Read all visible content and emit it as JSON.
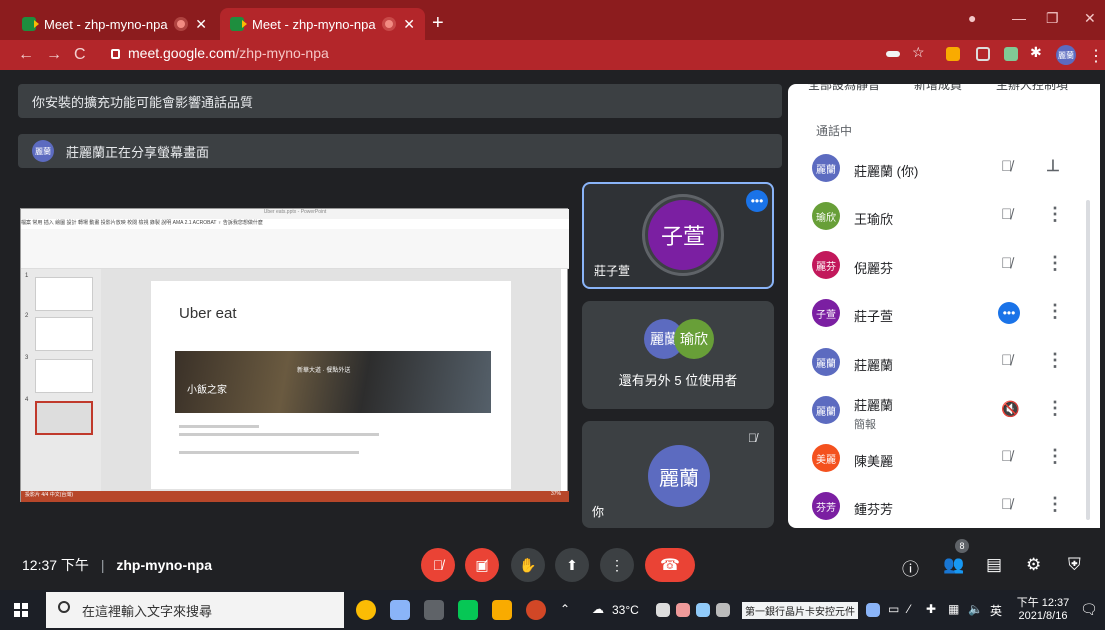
{
  "browser": {
    "tabs": [
      {
        "label": "Meet - zhp-myno-npa"
      },
      {
        "label": "Meet - zhp-myno-npa"
      }
    ],
    "new_tab": "+",
    "url_host": "meet.google.com",
    "url_path": "/zhp-myno-npa",
    "profile_initials": "麗蘭"
  },
  "meeting": {
    "banner_ext": "你安裝的擴充功能可能會影響通話品質",
    "banner_share": "莊麗蘭正在分享螢幕畫面",
    "sharer_initials": "麗蘭",
    "slide": {
      "window_title": "Uber eats.pptx - PowerPoint",
      "menu": "檔案 常用 插入 繪圖 設計 轉場 動畫 投影片放映 校閱 檢視 錄製 說明 AMA 2.1 ACROBAT ♀ 告訴我您想做什麼",
      "title": "Uber eat",
      "photo_title": "小飯之家",
      "photo_caption": "新華大道 · 餐點外送",
      "status": "投影片 4/4  中文(台灣)",
      "slide_numbers": [
        "1",
        "2",
        "3",
        "4"
      ],
      "zoom": "37%"
    },
    "tiles": [
      {
        "name": "莊子萱",
        "initials": "子萱",
        "color": "#7b1fa2"
      },
      {
        "name": "還有另外 5 位使用者",
        "initials_a": "麗蘭",
        "initials_b": "瑜欣",
        "color_a": "#5c6bc0",
        "color_b": "#689f38"
      },
      {
        "name": "你",
        "initials": "麗蘭",
        "color": "#5c6bc0"
      }
    ]
  },
  "panel": {
    "actions": [
      "全部設為靜音",
      "新增成員",
      "主辦人控制項"
    ],
    "section": "通話中",
    "people": [
      {
        "initials": "麗蘭",
        "name": "莊麗蘭 (你)",
        "sub": "",
        "color": "#5c6bc0",
        "mic": "mic-off",
        "action": "pin"
      },
      {
        "initials": "瑜欣",
        "name": "王瑜欣",
        "sub": "",
        "color": "#689f38",
        "mic": "mic-off",
        "action": "more"
      },
      {
        "initials": "麗芬",
        "name": "倪麗芬",
        "sub": "",
        "color": "#c2185b",
        "mic": "mic-off",
        "action": "more"
      },
      {
        "initials": "子萱",
        "name": "莊子萱",
        "sub": "",
        "color": "#7b1fa2",
        "mic": "speaking",
        "action": "more"
      },
      {
        "initials": "麗蘭",
        "name": "莊麗蘭",
        "sub": "",
        "color": "#5c6bc0",
        "mic": "mic-off",
        "action": "more"
      },
      {
        "initials": "麗蘭",
        "name": "莊麗蘭",
        "sub": "簡報",
        "color": "#5c6bc0",
        "mic": "presentation-muted",
        "action": "more"
      },
      {
        "initials": "美麗",
        "name": "陳美麗",
        "sub": "",
        "color": "#f4511e",
        "mic": "mic-off",
        "action": "more"
      },
      {
        "initials": "芬芳",
        "name": "鍾芬芳",
        "sub": "",
        "color": "#7b1fa2",
        "mic": "mic-off",
        "action": "more"
      }
    ]
  },
  "controls": {
    "time": "12:37 下午",
    "separator": "|",
    "code": "zhp-myno-npa",
    "people_count": "8"
  },
  "taskbar": {
    "search_placeholder": "在這裡輸入文字來搜尋",
    "temperature": "33°C",
    "notification": "第一銀行晶片卡安控元件",
    "ime": "英",
    "time": "下午 12:37",
    "date": "2021/8/16"
  }
}
